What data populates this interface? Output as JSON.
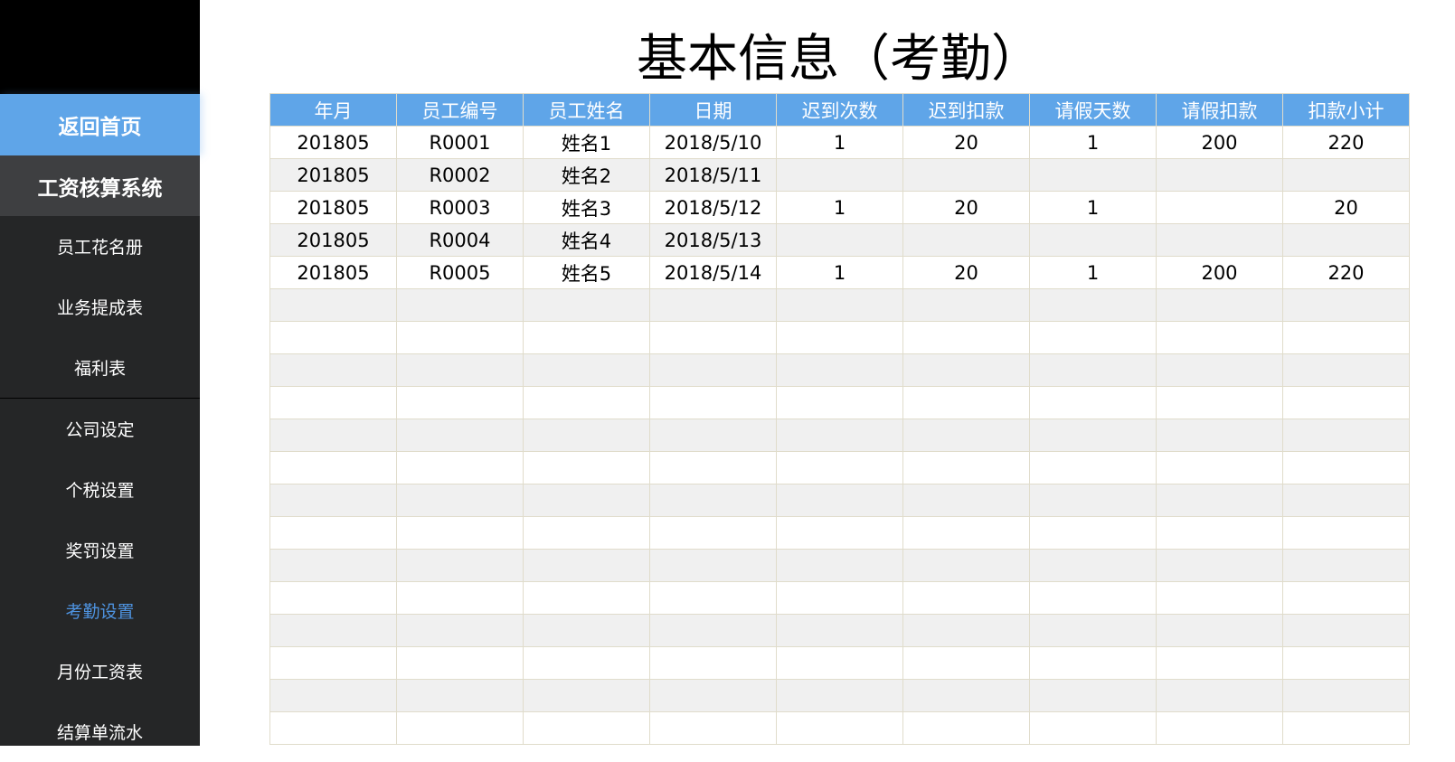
{
  "sidebar": {
    "home": "返回首页",
    "system": "工资核算系统",
    "items": [
      "员工花名册",
      "业务提成表",
      "福利表",
      "公司设定",
      "个税设置",
      "奖罚设置",
      "考勤设置",
      "月份工资表",
      "结算单流水"
    ],
    "active": "考勤设置"
  },
  "title": "基本信息（考勤）",
  "table": {
    "headers": [
      "年月",
      "员工编号",
      "员工姓名",
      "日期",
      "迟到次数",
      "迟到扣款",
      "请假天数",
      "请假扣款",
      "扣款小计"
    ],
    "rows": [
      [
        "201805",
        "R0001",
        "姓名1",
        "2018/5/10",
        "1",
        "20",
        "1",
        "200",
        "220"
      ],
      [
        "201805",
        "R0002",
        "姓名2",
        "2018/5/11",
        "",
        "",
        "",
        "",
        ""
      ],
      [
        "201805",
        "R0003",
        "姓名3",
        "2018/5/12",
        "1",
        "20",
        "1",
        "",
        "20"
      ],
      [
        "201805",
        "R0004",
        "姓名4",
        "2018/5/13",
        "",
        "",
        "",
        "",
        ""
      ],
      [
        "201805",
        "R0005",
        "姓名5",
        "2018/5/14",
        "1",
        "20",
        "1",
        "200",
        "220"
      ]
    ]
  },
  "colors": {
    "accent": "#5fa5e8",
    "sidebar": "#252627",
    "active": "#4e93e0"
  }
}
